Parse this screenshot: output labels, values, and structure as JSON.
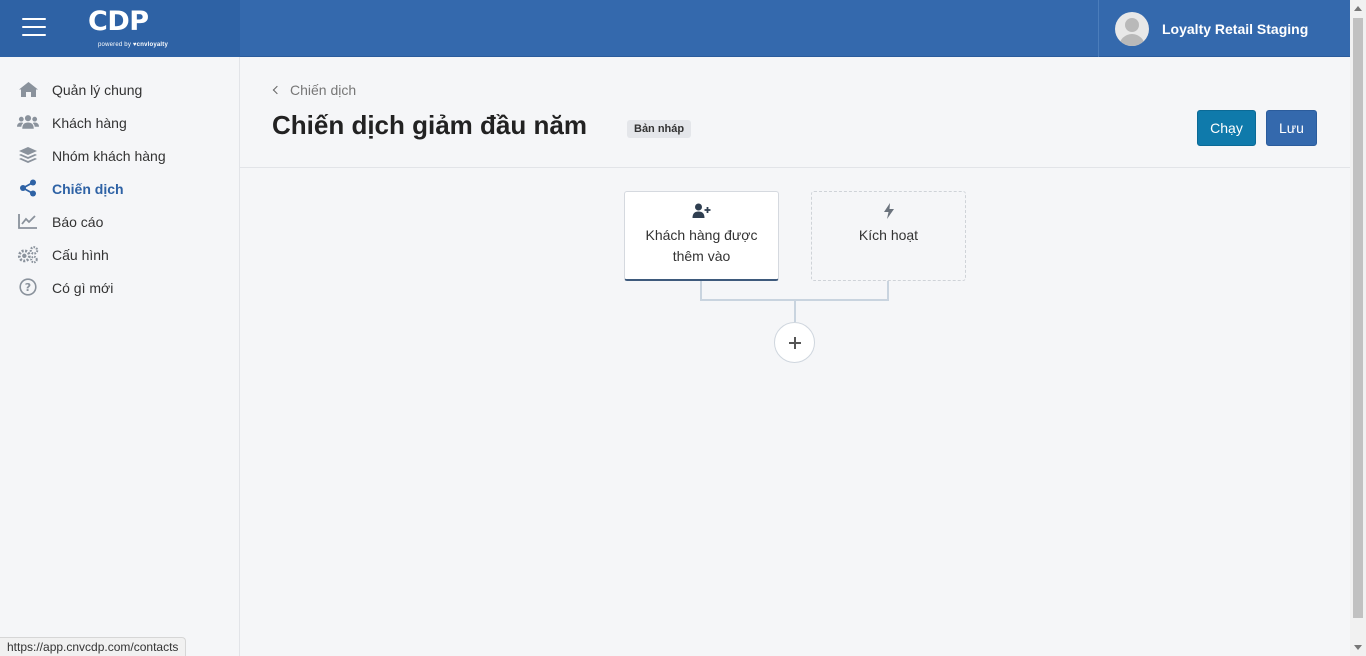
{
  "brand": {
    "logo": "CDP",
    "powered_by": "powered by",
    "powered_brand": "cnvloyalty"
  },
  "header": {
    "account_name": "Loyalty Retail Staging"
  },
  "sidebar": {
    "items": [
      {
        "label": "Quản lý chung",
        "icon": "home-icon"
      },
      {
        "label": "Khách hàng",
        "icon": "users-icon"
      },
      {
        "label": "Nhóm khách hàng",
        "icon": "layers-icon"
      },
      {
        "label": "Chiến dịch",
        "icon": "share-icon",
        "active": true
      },
      {
        "label": "Báo cáo",
        "icon": "chart-line-icon"
      },
      {
        "label": "Cấu hình",
        "icon": "gears-icon"
      },
      {
        "label": "Có gì mới",
        "icon": "question-circle-icon"
      }
    ]
  },
  "breadcrumb": {
    "label": "Chiến dịch"
  },
  "page": {
    "title": "Chiến dịch giảm đầu năm",
    "status": "Bản nháp"
  },
  "actions": {
    "run_label": "Chạy",
    "save_label": "Lưu"
  },
  "flow": {
    "triggers": [
      {
        "label": "Khách hàng được thêm vào",
        "icon": "user-plus-icon"
      },
      {
        "label": "Kích hoạt",
        "icon": "bolt-icon"
      }
    ],
    "add_step_icon": "plus-icon"
  },
  "statusbar": {
    "url": "https://app.cnvcdp.com/contacts"
  },
  "colors": {
    "primary": "#3469ad",
    "run_button": "#0f7aab",
    "active_nav": "#2e62a5"
  }
}
